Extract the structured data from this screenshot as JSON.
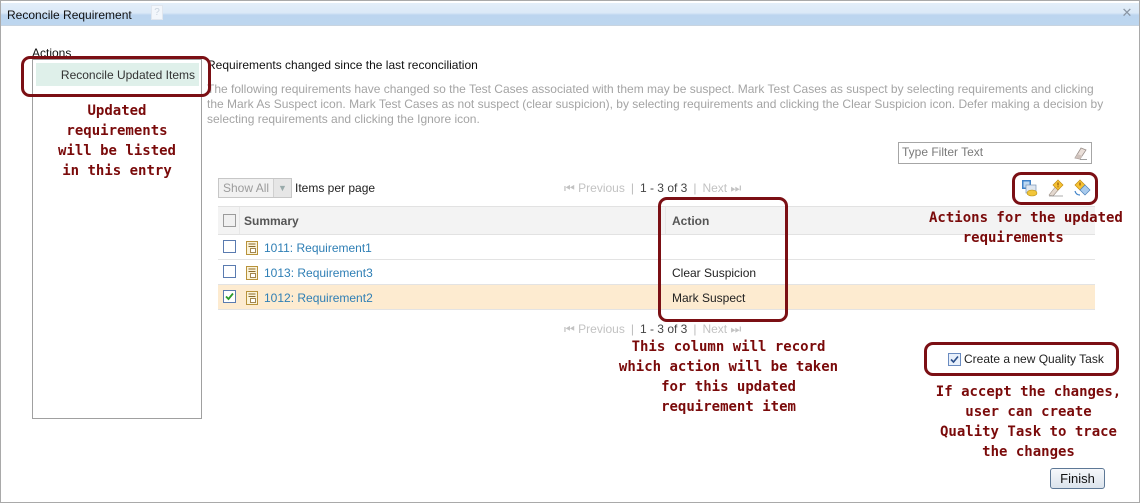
{
  "dialog": {
    "title": "Reconcile Requirement",
    "help_icon": "help-icon",
    "close_icon": "close-icon"
  },
  "left": {
    "actions_label": "Actions",
    "items": [
      {
        "label": "Reconcile Updated Items",
        "selected": true
      }
    ]
  },
  "main": {
    "section_title": "Requirements changed since the last reconciliation",
    "description": "The following requirements have changed so the Test Cases associated with them may be suspect. Mark Test Cases as suspect by selecting requirements and clicking the Mark As Suspect icon. Mark Test Cases as not suspect (clear suspicion), by selecting requirements and clicking the Clear Suspicion icon. Defer making a decision by selecting requirements and clicking the Ignore icon.",
    "filter": {
      "placeholder": "Type Filter Text",
      "value": "",
      "clear_icon": "eraser-icon"
    },
    "page_size": {
      "selected": "Show All",
      "label": "Items per page"
    },
    "pager": {
      "previous": "Previous",
      "range": "1 - 3 of 3",
      "next": "Next"
    },
    "toolbar": [
      {
        "name": "ignore-icon"
      },
      {
        "name": "mark-suspect-icon"
      },
      {
        "name": "clear-suspicion-icon"
      }
    ],
    "table": {
      "columns": [
        "Summary",
        "Action"
      ],
      "rows": [
        {
          "summary": "1011: Requirement1",
          "action": "",
          "checked": false,
          "selected": false
        },
        {
          "summary": "1013: Requirement3",
          "action": "Clear Suspicion",
          "checked": false,
          "selected": false
        },
        {
          "summary": "1012: Requirement2",
          "action": "Mark Suspect",
          "checked": true,
          "selected": true
        }
      ]
    },
    "quality_task": {
      "label": "Create a new Quality Task",
      "checked": true
    },
    "finish_label": "Finish"
  },
  "annotations": {
    "left": "Updated\nrequirements\nwill be listed\nin this entry",
    "toolbar": "Actions for the updated\n    requirements",
    "action_column": "This column will record\nwhich action will be taken\nfor this updated\nrequirement item",
    "quality_task": "If accept the changes,\nuser can create\nQuality Task to trace\nthe changes"
  },
  "colors": {
    "annotation": "#7b0f14",
    "link": "#2f7fb5",
    "selected_row": "#fdebd0",
    "left_selected": "#dff0ea"
  }
}
